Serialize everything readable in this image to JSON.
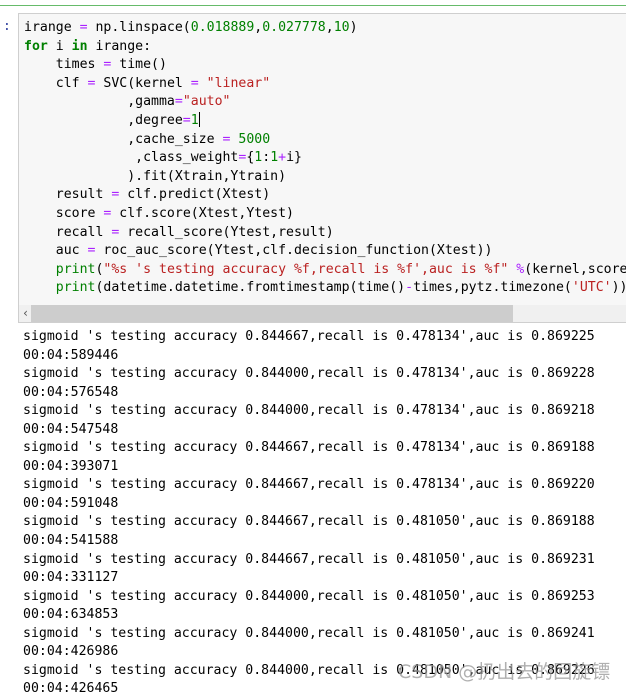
{
  "cell": {
    "prompt": ":",
    "code_lines": [
      [
        [
          "irange ",
          ""
        ],
        [
          "=",
          "op"
        ],
        [
          " np.linspace(",
          ""
        ],
        [
          "0.018889",
          "num"
        ],
        [
          ",",
          ""
        ],
        [
          "0.027778",
          "num"
        ],
        [
          ",",
          ""
        ],
        [
          "10",
          "num"
        ],
        [
          ")",
          ""
        ]
      ],
      [
        [
          "for",
          "kw"
        ],
        [
          " i ",
          ""
        ],
        [
          "in",
          "kw"
        ],
        [
          " irange:",
          ""
        ]
      ],
      [
        [
          "    times ",
          ""
        ],
        [
          "=",
          "op"
        ],
        [
          " time()",
          ""
        ]
      ],
      [
        [
          "    clf ",
          ""
        ],
        [
          "=",
          "op"
        ],
        [
          " SVC(kernel ",
          ""
        ],
        [
          "=",
          "op"
        ],
        [
          " ",
          ""
        ],
        [
          "\"linear\"",
          "str"
        ]
      ],
      [
        [
          "             ,gamma",
          ""
        ],
        [
          "=",
          "op"
        ],
        [
          "\"auto\"",
          "str"
        ]
      ],
      [
        [
          "             ,degree",
          ""
        ],
        [
          "=",
          "op"
        ],
        [
          "1",
          "num"
        ],
        [
          "|",
          "cursor"
        ]
      ],
      [
        [
          "             ,cache_size ",
          ""
        ],
        [
          "=",
          "op"
        ],
        [
          " ",
          ""
        ],
        [
          "5000",
          "num"
        ]
      ],
      [
        [
          "              ,class_weight",
          ""
        ],
        [
          "=",
          "op"
        ],
        [
          "{",
          ""
        ],
        [
          "1",
          "num"
        ],
        [
          ":",
          ""
        ],
        [
          "1",
          "num"
        ],
        [
          "+",
          "op"
        ],
        [
          "i}",
          ""
        ]
      ],
      [
        [
          "             ).fit(Xtrain,Ytrain)",
          ""
        ]
      ],
      [
        [
          "    result ",
          ""
        ],
        [
          "=",
          "op"
        ],
        [
          " clf.predict(Xtest)",
          ""
        ]
      ],
      [
        [
          "    score ",
          ""
        ],
        [
          "=",
          "op"
        ],
        [
          " clf.score(Xtest,Ytest)",
          ""
        ]
      ],
      [
        [
          "    recall ",
          ""
        ],
        [
          "=",
          "op"
        ],
        [
          " recall_score(Ytest,result)",
          ""
        ]
      ],
      [
        [
          "    auc ",
          ""
        ],
        [
          "=",
          "op"
        ],
        [
          " roc_auc_score(Ytest,clf.decision_function(Xtest))",
          ""
        ]
      ],
      [
        [
          "    ",
          ""
        ],
        [
          "print",
          "bi"
        ],
        [
          "(",
          ""
        ],
        [
          "\"%s 's testing accuracy %f,recall is %f',auc is %f\"",
          "str"
        ],
        [
          " ",
          ""
        ],
        [
          "%",
          "op"
        ],
        [
          "(kernel,score,recall,auc))",
          ""
        ]
      ],
      [
        [
          "    ",
          ""
        ],
        [
          "print",
          "bi"
        ],
        [
          "(datetime.datetime.fromtimestamp(time()",
          ""
        ],
        [
          "-",
          "op"
        ],
        [
          "times,pytz.timezone(",
          ""
        ],
        [
          "'UTC'",
          "str"
        ],
        [
          ")).strftime(\"%H:%M:%f\"))",
          ""
        ]
      ]
    ],
    "scroll_left_icon": "chevron-left-icon"
  },
  "output_lines": [
    "sigmoid 's testing accuracy 0.844667,recall is 0.478134',auc is 0.869225",
    "00:04:589446",
    "sigmoid 's testing accuracy 0.844000,recall is 0.478134',auc is 0.869228",
    "00:04:576548",
    "sigmoid 's testing accuracy 0.844000,recall is 0.478134',auc is 0.869218",
    "00:04:547548",
    "sigmoid 's testing accuracy 0.844667,recall is 0.478134',auc is 0.869188",
    "00:04:393071",
    "sigmoid 's testing accuracy 0.844667,recall is 0.478134',auc is 0.869220",
    "00:04:591048",
    "sigmoid 's testing accuracy 0.844667,recall is 0.481050',auc is 0.869188",
    "00:04:541588",
    "sigmoid 's testing accuracy 0.844667,recall is 0.481050',auc is 0.869231",
    "00:04:331127",
    "sigmoid 's testing accuracy 0.844000,recall is 0.481050',auc is 0.869253",
    "00:04:634853",
    "sigmoid 's testing accuracy 0.844000,recall is 0.481050',auc is 0.869241",
    "00:04:426986",
    "sigmoid 's testing accuracy 0.844000,recall is 0.481050',auc is 0.869226",
    "00:04:426465"
  ],
  "watermark": "CSDN @扔出去的回旋镖"
}
